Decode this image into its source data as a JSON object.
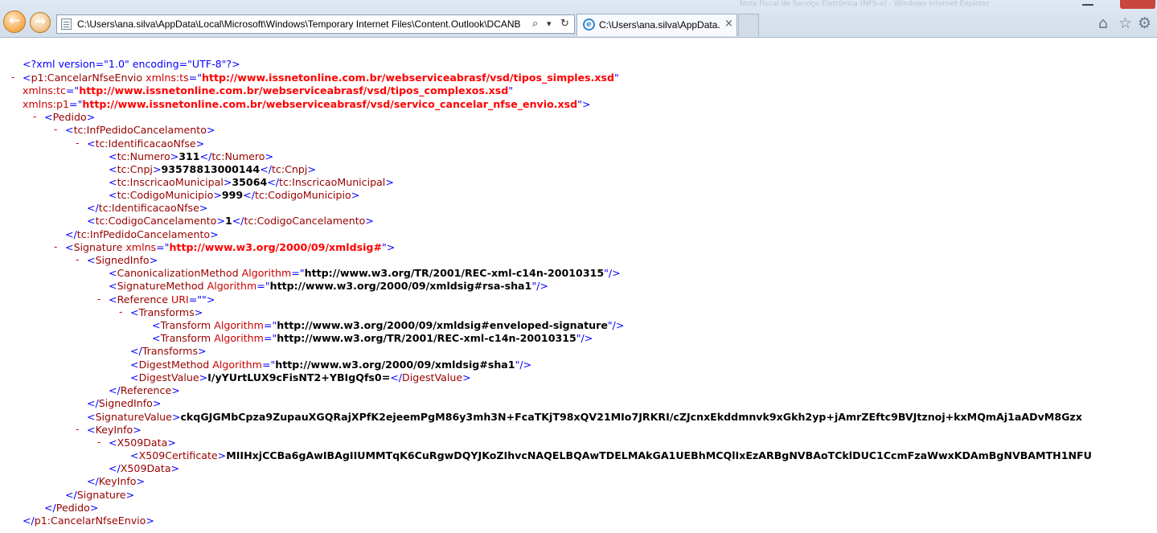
{
  "browser": {
    "address": "C:\\Users\\ana.silva\\AppData\\Local\\Microsoft\\Windows\\Temporary Internet Files\\Content.Outlook\\DCANB",
    "tab_title": "C:\\Users\\ana.silva\\AppData...",
    "tab_close": "×",
    "search_glyph": "⌕",
    "dropdown_glyph": "▾",
    "refresh_glyph": "↻",
    "home_glyph": "⌂",
    "favorites_glyph": "☆",
    "tools_glyph": "⚙",
    "back_glyph": "←",
    "forward_glyph": "→",
    "faded_text": "Nota Fiscal de Serviço Eletrônica (NFS-e) - Windows Internet Explorer"
  },
  "xml": {
    "expander": "-",
    "declaration": "<?xml version=\"1.0\" encoding=\"UTF-8\"?>",
    "root_tag": "p1:CancelarNfseEnvio",
    "ns_ts_attr": "xmlns:ts",
    "ns_ts_value": "http://www.issnetonline.com.br/webserviceabrasf/vsd/tipos_simples.xsd",
    "ns_tc_attr": "xmlns:tc",
    "ns_tc_value": "http://www.issnetonline.com.br/webserviceabrasf/vsd/tipos_complexos.xsd",
    "ns_p1_attr": "xmlns:p1",
    "ns_p1_value": "http://www.issnetonline.com.br/webserviceabrasf/vsd/servico_cancelar_nfse_envio.xsd",
    "pedido": "Pedido",
    "inf_pedido": "tc:InfPedidoCancelamento",
    "identificacao": "tc:IdentificacaoNfse",
    "numero_tag": "tc:Numero",
    "numero_value": "311",
    "cnpj_tag": "tc:Cnpj",
    "cnpj_value": "93578813000144",
    "inscricao_tag": "tc:InscricaoMunicipal",
    "inscricao_value": "35064",
    "codmun_tag": "tc:CodigoMunicipio",
    "codmun_value": "999",
    "codcanc_tag": "tc:CodigoCancelamento",
    "codcanc_value": "1",
    "signature_tag": "Signature",
    "xmlns_attr": "xmlns",
    "signature_ns": "http://www.w3.org/2000/09/xmldsig#",
    "signed_info": "SignedInfo",
    "canon_tag": "CanonicalizationMethod",
    "algorithm_attr": "Algorithm",
    "canon_value": "http://www.w3.org/TR/2001/REC-xml-c14n-20010315",
    "sigmethod_tag": "SignatureMethod",
    "sigmethod_value": "http://www.w3.org/2000/09/xmldsig#rsa-sha1",
    "reference_tag": "Reference",
    "uri_attr": "URI",
    "uri_value": "",
    "transforms_tag": "Transforms",
    "transform_tag": "Transform",
    "transform1_value": "http://www.w3.org/2000/09/xmldsig#enveloped-signature",
    "transform2_value": "http://www.w3.org/TR/2001/REC-xml-c14n-20010315",
    "digestmethod_tag": "DigestMethod",
    "digestmethod_value": "http://www.w3.org/2000/09/xmldsig#sha1",
    "digestvalue_tag": "DigestValue",
    "digestvalue_value": "I/yYUrtLUX9cFisNT2+YBIgQfs0=",
    "sigvalue_tag": "SignatureValue",
    "sigvalue_value": "ckqGJGMbCpza9ZupauXGQRajXPfK2ejeemPgM86y3mh3N+FcaTKjT98xQV21MIo7JRKRI/cZJcnxEkddmnvk9xGkh2yp+jAmrZEftc9BVJtznoj+kxMQmAj1aADvM8Gzx",
    "keyinfo_tag": "KeyInfo",
    "x509data_tag": "X509Data",
    "x509cert_tag": "X509Certificate",
    "x509cert_value": "MIIHxjCCBa6gAwIBAgIIUMMTqK6CuRgwDQYJKoZIhvcNAQELBQAwTDELMAkGA1UEBhMCQlIxEzARBgNVBAoTCklDUC1CcmFzaWwxKDAmBgNVBAMTH1NFU"
  }
}
